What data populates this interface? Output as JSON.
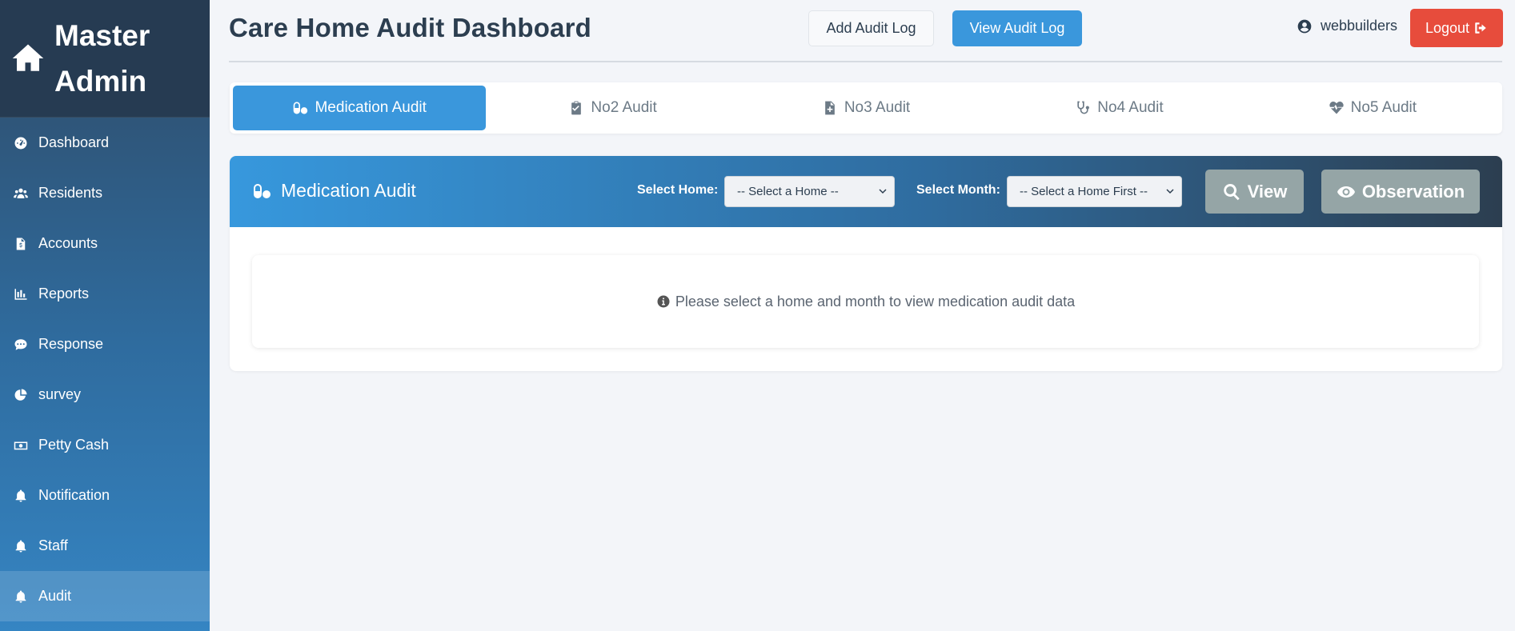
{
  "brand": {
    "title": "Master Admin"
  },
  "sidebar": {
    "items": [
      {
        "label": "Dashboard",
        "icon": "tachometer-icon"
      },
      {
        "label": "Residents",
        "icon": "users-icon"
      },
      {
        "label": "Accounts",
        "icon": "invoice-icon"
      },
      {
        "label": "Reports",
        "icon": "bar-chart-icon"
      },
      {
        "label": "Response",
        "icon": "comments-icon"
      },
      {
        "label": "survey",
        "icon": "pie-chart-icon"
      },
      {
        "label": "Petty Cash",
        "icon": "money-icon"
      },
      {
        "label": "Notification",
        "icon": "bell-icon"
      },
      {
        "label": "Staff",
        "icon": "bell-icon"
      },
      {
        "label": "Audit",
        "icon": "bell-icon",
        "active": true
      }
    ]
  },
  "header": {
    "title": "Care Home Audit Dashboard",
    "add_audit_log": "Add Audit Log",
    "view_audit_log": "View Audit Log",
    "username": "webbuilders",
    "logout": "Logout"
  },
  "tabs": [
    {
      "label": "Medication Audit",
      "icon": "pills-icon",
      "active": true
    },
    {
      "label": "No2 Audit",
      "icon": "clipboard-check-icon"
    },
    {
      "label": "No3 Audit",
      "icon": "file-medical-icon"
    },
    {
      "label": "No4 Audit",
      "icon": "stethoscope-icon"
    },
    {
      "label": "No5 Audit",
      "icon": "heartbeat-icon"
    }
  ],
  "panel": {
    "title": "Medication Audit",
    "home_label": "Select Home:",
    "home_select": "-- Select a Home --",
    "month_label": "Select Month:",
    "month_select": "-- Select a Home First --",
    "view_button": "View",
    "observation_button": "Observation",
    "info_message": "Please select a home and month to view medication audit data"
  },
  "colors": {
    "primary": "#3a97dc",
    "danger": "#e74c3c",
    "muted_button": "#95a5a6",
    "dark": "#2c3e50"
  }
}
